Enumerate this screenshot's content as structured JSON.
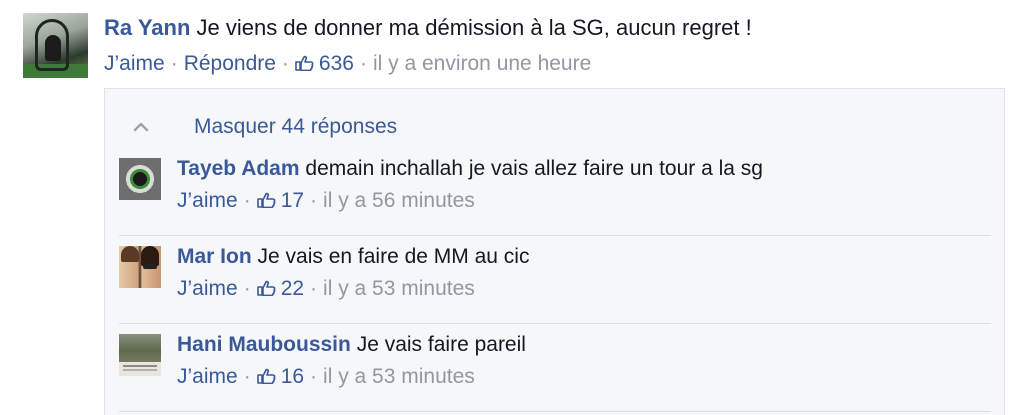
{
  "main_comment": {
    "author": "Ra Yann",
    "text": "Je viens de donner ma démission à la SG, aucun regret !",
    "like_label": "J’aime",
    "reply_label": "Répondre",
    "like_count": "636",
    "time": "il y a environ une heure"
  },
  "replies_block": {
    "hide_label": "Masquer 44 réponses",
    "items": [
      {
        "author": "Tayeb Adam",
        "text": "demain inchallah je vais allez faire un tour a la sg",
        "like_label": "J’aime",
        "like_count": "17",
        "time": "il y a 56 minutes"
      },
      {
        "author": "Mar Ion",
        "text": "Je vais en faire de MM au cic",
        "like_label": "J’aime",
        "like_count": "22",
        "time": "il y a 53 minutes"
      },
      {
        "author": "Hani Mauboussin",
        "text": "Je vais faire pareil",
        "like_label": "J’aime",
        "like_count": "16",
        "time": "il y a 53 minutes"
      }
    ]
  },
  "separator": "·",
  "colors": {
    "link": "#3b5998",
    "meta": "#9197a3",
    "text": "#141823",
    "replies_bg": "#f6f7f9"
  },
  "icons": [
    "thumbs-up-icon",
    "chevron-up-icon"
  ]
}
